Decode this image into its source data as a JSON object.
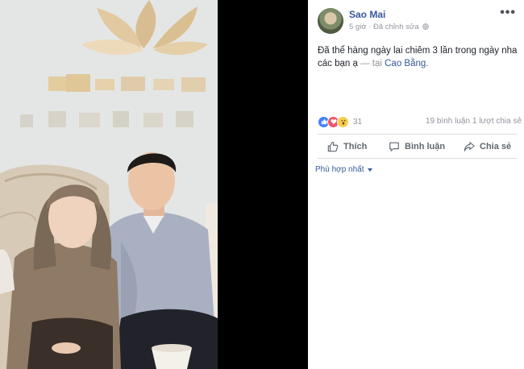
{
  "post": {
    "author": "Sao Mai",
    "time": "5 giờ",
    "edited": "Đã chỉnh sửa",
    "text": "Đã thể hàng ngày lai chiêm 3 lần trong ngày nha các bạn ạ",
    "tagged_prefix": "— tại",
    "location": "Cao Bằng.",
    "reaction_count": "31",
    "comments": "19 bình luận",
    "shares": "1 lượt chia sẻ",
    "more_icon": "ellipsis-icon"
  },
  "actions": {
    "like": "Thích",
    "comment": "Bình luận",
    "share": "Chia sẻ"
  },
  "sort": {
    "label": "Phù hợp nhất"
  },
  "colors": {
    "link": "#365899",
    "muted": "#90949c",
    "like": "#4080ff",
    "love": "#f25268",
    "wow": "#f7cf4f"
  }
}
